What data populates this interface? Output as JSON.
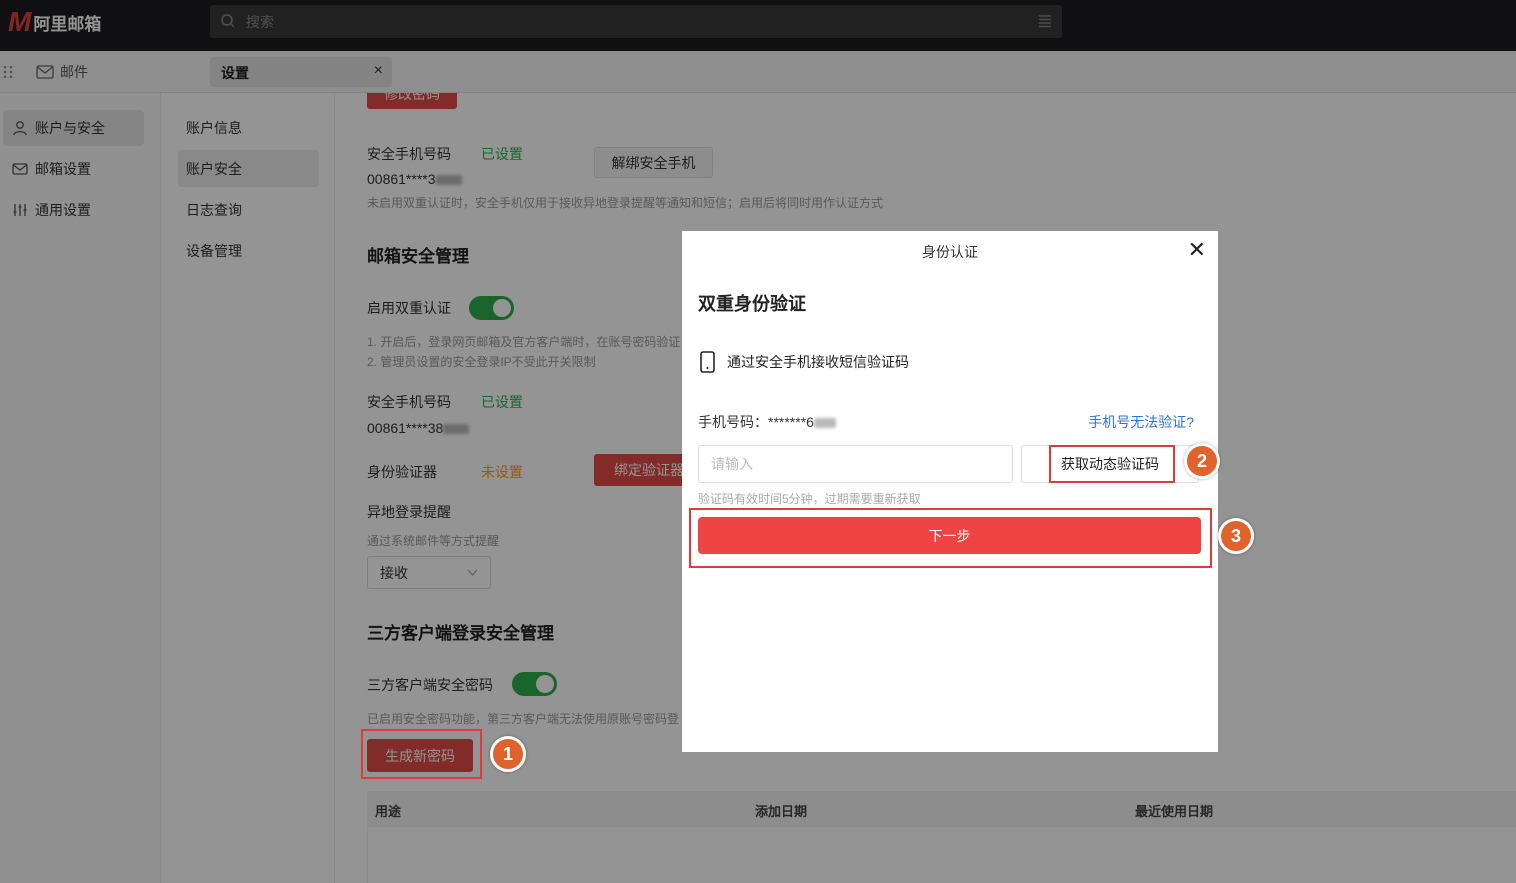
{
  "app": {
    "logo_mark": "M",
    "logo_text": "阿里邮箱"
  },
  "search": {
    "placeholder": "搜索"
  },
  "tabs": {
    "mail_label": "邮件",
    "settings_label": "设置",
    "close": "×"
  },
  "nav_primary": [
    {
      "label": "账户与安全",
      "icon": "user-icon"
    },
    {
      "label": "邮箱设置",
      "icon": "mail-settings-icon"
    },
    {
      "label": "通用设置",
      "icon": "sliders-icon"
    }
  ],
  "nav_secondary": [
    "账户信息",
    "账户安全",
    "日志查询",
    "设备管理"
  ],
  "main": {
    "modify_password": "修改密码",
    "phone_label": "安全手机号码",
    "phone_status": "已设置",
    "unbind_phone": "解绑安全手机",
    "phone_value": "00861****3",
    "phone_hint": "未启用双重认证时，安全手机仅用于接收异地登录提醒等通知和短信；启用后将同时用作认证方式",
    "mailbox_security_title": "邮箱安全管理",
    "two_factor_label": "启用双重认证",
    "two_factor_hint1": "1. 开启后，登录网页邮箱及官方客户端时，在账号密码验证",
    "two_factor_hint2": "2. 管理员设置的安全登录IP不受此开关限制",
    "phone_label2": "安全手机号码",
    "phone_status2": "已设置",
    "phone_value2": "00861****38",
    "authenticator_label": "身份验证器",
    "authenticator_status": "未设置",
    "bind_authenticator": "绑定验证器",
    "remote_login_title": "异地登录提醒",
    "remote_login_hint": "通过系统邮件等方式提醒",
    "remote_login_select": "接收",
    "third_party_title": "三方客户端登录安全管理",
    "third_party_pw_label": "三方客户端安全密码",
    "third_party_hint": "已启用安全密码功能，第三方客户端无法使用原账号密码登",
    "generate_password": "生成新密码",
    "table_headers": [
      "用途",
      "添加日期",
      "最近使用日期"
    ]
  },
  "modal": {
    "title": "身份认证",
    "heading": "双重身份验证",
    "method_label": "通过安全手机接收短信验证码",
    "phone_prefix": "手机号码：",
    "phone_value": "*******6",
    "cannot_verify": "手机号无法验证?",
    "code_placeholder": "请输入",
    "get_code": "获取动态验证码",
    "code_hint": "验证码有效时间5分钟，过期需要重新获取",
    "next": "下一步"
  },
  "markers": [
    "1",
    "2",
    "3"
  ],
  "colors": {
    "accent_red": "#ef4444",
    "green": "#2cae4c",
    "orange": "#f5a000",
    "link": "#2f73d8",
    "marker": "#e0632b"
  }
}
